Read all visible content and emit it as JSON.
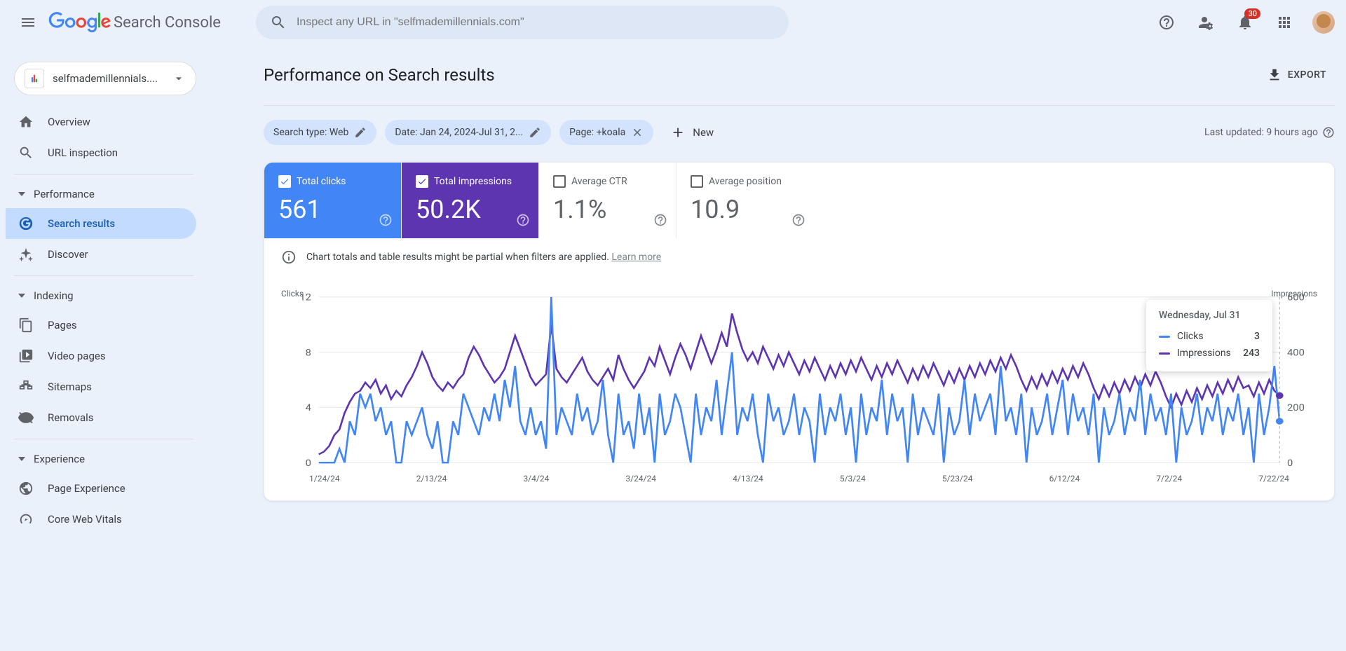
{
  "header": {
    "product_name": "Search Console",
    "search_placeholder": "Inspect any URL in \"selfmademillennials.com\"",
    "notification_count": "30"
  },
  "sidebar": {
    "property_name": "selfmademillennials....",
    "items": {
      "overview": "Overview",
      "url_inspection": "URL inspection",
      "search_results": "Search results",
      "discover": "Discover",
      "pages": "Pages",
      "video_pages": "Video pages",
      "sitemaps": "Sitemaps",
      "removals": "Removals",
      "page_experience": "Page Experience",
      "core_web_vitals": "Core Web Vitals"
    },
    "sections": {
      "performance": "Performance",
      "indexing": "Indexing",
      "experience": "Experience"
    }
  },
  "page": {
    "title": "Performance on Search results",
    "export": "EXPORT",
    "filters": {
      "search_type": "Search type: Web",
      "date": "Date: Jan 24, 2024-Jul 31, 2...",
      "page": "Page: +koala",
      "new": "New"
    },
    "last_updated": "Last updated: 9 hours ago"
  },
  "metrics": {
    "clicks_label": "Total clicks",
    "clicks_value": "561",
    "impressions_label": "Total impressions",
    "impressions_value": "50.2K",
    "ctr_label": "Average CTR",
    "ctr_value": "1.1%",
    "position_label": "Average position",
    "position_value": "10.9"
  },
  "info": {
    "text": "Chart totals and table results might be partial when filters are applied.",
    "learn_more": "Learn more"
  },
  "chart": {
    "left_axis_title": "Clicks",
    "right_axis_title": "Impressions",
    "y_left_ticks": [
      "12",
      "8",
      "4",
      "0"
    ],
    "y_right_ticks": [
      "600",
      "400",
      "200",
      "0"
    ],
    "x_ticks": [
      "1/24/24",
      "2/13/24",
      "3/4/24",
      "3/24/24",
      "4/13/24",
      "5/3/24",
      "5/23/24",
      "6/12/24",
      "7/2/24",
      "7/22/24"
    ],
    "tooltip": {
      "title": "Wednesday, Jul 31",
      "clicks_label": "Clicks",
      "clicks_value": "3",
      "impressions_label": "Impressions",
      "impressions_value": "243"
    }
  },
  "colors": {
    "clicks": "#4285f4",
    "impressions": "#5e35b1"
  },
  "chart_data": {
    "type": "line",
    "title": "Performance on Search results",
    "x_ticks": [
      "1/24/24",
      "2/13/24",
      "3/4/24",
      "3/24/24",
      "4/13/24",
      "5/3/24",
      "5/23/24",
      "6/12/24",
      "7/2/24",
      "7/22/24"
    ],
    "series": [
      {
        "name": "Clicks",
        "axis": "left",
        "ylabel": "Clicks",
        "ylim": [
          0,
          12
        ],
        "values": [
          0,
          0,
          0,
          0,
          1,
          0,
          3,
          2,
          5,
          4,
          5,
          3,
          4,
          2,
          3,
          0,
          0,
          3,
          2,
          3,
          4,
          2,
          1,
          3,
          0,
          0,
          3,
          2,
          5,
          4,
          3,
          2,
          4,
          3,
          5,
          3,
          6,
          4,
          7,
          3,
          2,
          4,
          2,
          3,
          1,
          12,
          2,
          4,
          3,
          2,
          5,
          3,
          4,
          2,
          3,
          6,
          2,
          0,
          5,
          2,
          3,
          1,
          5,
          2,
          4,
          0,
          5,
          2,
          3,
          5,
          4,
          2,
          0,
          5,
          2,
          4,
          3,
          6,
          2,
          5,
          8,
          2,
          4,
          3,
          5,
          2,
          0,
          5,
          3,
          4,
          2,
          3,
          5,
          2,
          4,
          3,
          0,
          5,
          2,
          4,
          3,
          5,
          2,
          4,
          0,
          5,
          2,
          4,
          3,
          6,
          2,
          5,
          3,
          4,
          0,
          5,
          2,
          4,
          3,
          2,
          5,
          0,
          4,
          2,
          3,
          6,
          2,
          5,
          3,
          4,
          5,
          2,
          7,
          3,
          4,
          2,
          5,
          0,
          4,
          2,
          3,
          5,
          2,
          4,
          6,
          2,
          5,
          3,
          4,
          2,
          5,
          0,
          4,
          2,
          3,
          5,
          2,
          4,
          3,
          6,
          2,
          5,
          3,
          4,
          2,
          5,
          0,
          4,
          2,
          3,
          5,
          2,
          4,
          3,
          5,
          2,
          4,
          3,
          5,
          2,
          4,
          0,
          5,
          2,
          4,
          7,
          3
        ]
      },
      {
        "name": "Impressions",
        "axis": "right",
        "ylabel": "Impressions",
        "ylim": [
          0,
          600
        ],
        "values": [
          30,
          40,
          60,
          100,
          120,
          180,
          220,
          250,
          260,
          290,
          270,
          300,
          250,
          280,
          230,
          260,
          240,
          280,
          310,
          350,
          400,
          360,
          310,
          280,
          260,
          290,
          270,
          300,
          320,
          380,
          420,
          390,
          350,
          320,
          290,
          310,
          340,
          400,
          460,
          410,
          360,
          310,
          280,
          300,
          320,
          500,
          340,
          310,
          290,
          320,
          350,
          380,
          330,
          300,
          280,
          310,
          340,
          300,
          390,
          340,
          300,
          270,
          300,
          330,
          380,
          350,
          420,
          370,
          320,
          380,
          430,
          390,
          340,
          400,
          460,
          410,
          360,
          410,
          470,
          420,
          540,
          470,
          410,
          370,
          400,
          360,
          420,
          380,
          340,
          390,
          350,
          400,
          360,
          320,
          370,
          330,
          380,
          340,
          300,
          350,
          310,
          360,
          320,
          370,
          330,
          380,
          340,
          300,
          350,
          310,
          360,
          320,
          370,
          330,
          290,
          340,
          300,
          350,
          310,
          360,
          320,
          280,
          330,
          290,
          340,
          300,
          350,
          310,
          360,
          320,
          370,
          330,
          380,
          340,
          390,
          350,
          300,
          260,
          310,
          270,
          320,
          280,
          330,
          290,
          340,
          300,
          350,
          310,
          360,
          320,
          270,
          230,
          280,
          240,
          290,
          250,
          300,
          260,
          310,
          270,
          320,
          280,
          330,
          290,
          240,
          200,
          250,
          210,
          260,
          220,
          270,
          230,
          280,
          240,
          290,
          250,
          300,
          260,
          310,
          270,
          280,
          240,
          290,
          250,
          300,
          260,
          243
        ]
      }
    ]
  }
}
